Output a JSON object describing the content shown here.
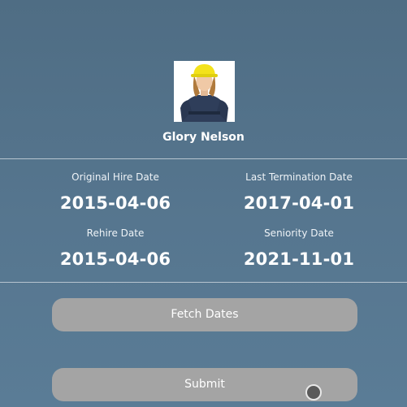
{
  "employee": {
    "name": "Glory Nelson",
    "avatar_icon": "worker-photo"
  },
  "dates": {
    "original_hire": {
      "label": "Original Hire Date",
      "value": "2015-04-06"
    },
    "last_termination": {
      "label": "Last Termination Date",
      "value": "2017-04-01"
    },
    "rehire": {
      "label": "Rehire Date",
      "value": "2015-04-06"
    },
    "seniority": {
      "label": "Seniority Date",
      "value": "2021-11-01"
    }
  },
  "buttons": {
    "fetch_label": "Fetch Dates",
    "submit_label": "Submit"
  },
  "colors": {
    "background": "#56768f",
    "button": "#a4a4a4",
    "divider": "#b6c4cf"
  }
}
